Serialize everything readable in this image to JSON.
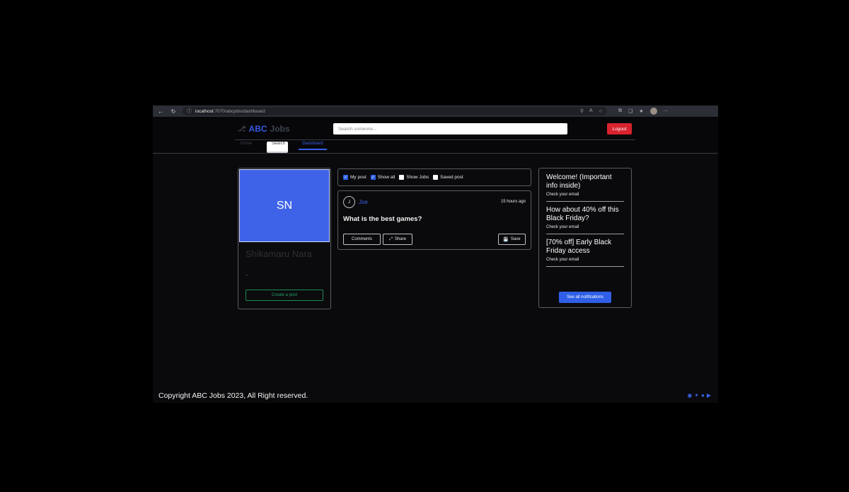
{
  "browser": {
    "url_host": "localhost",
    "url_path": ":7070/abcjobs/dashboard"
  },
  "header": {
    "logo_abc": "ABC",
    "logo_jobs": "Jobs",
    "search_placeholder": "Search someone...",
    "logout_label": "Logout",
    "tabs": [
      {
        "label": "Home"
      },
      {
        "label": "Search"
      },
      {
        "label": "Dashboard"
      }
    ]
  },
  "profile": {
    "initials": "SN",
    "name": "Shikamaru Nara",
    "subtitle": "-",
    "create_post_label": "Create a post"
  },
  "filters": [
    {
      "label": "My post",
      "checked": true
    },
    {
      "label": "Show all",
      "checked": true
    },
    {
      "label": "Show Jobs",
      "checked": false
    },
    {
      "label": "Saved post",
      "checked": false
    }
  ],
  "post": {
    "author_initial": "J",
    "author": "Joe",
    "time": "15 hours ago",
    "title": "What is the best games?",
    "comments_label": "Comments",
    "share_label": "Share",
    "save_label": "Save"
  },
  "notifications": {
    "items": [
      {
        "title": "Welcome! (Important info inside)",
        "subtitle": "Check your email"
      },
      {
        "title": "How about 40% off this Black Friday?",
        "subtitle": "Check your email"
      },
      {
        "title": "[70% off] Early Black Friday access",
        "subtitle": "Check your email"
      }
    ],
    "see_all_label": "See all notifications"
  },
  "footer": {
    "copyright": "Copyright ABC Jobs 2023, All Right reserved.",
    "social_icons": [
      "github-icon",
      "twitter-icon",
      "facebook-icon",
      "youtube-icon"
    ]
  },
  "colors": {
    "accent": "#3559e0",
    "danger": "#d9232e",
    "success": "#1d8a52"
  }
}
